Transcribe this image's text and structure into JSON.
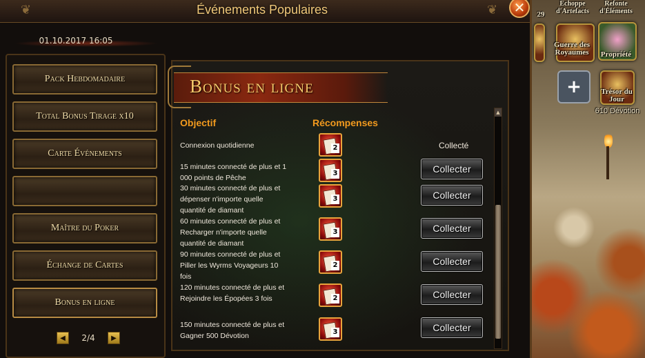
{
  "window": {
    "title": "Événements Populaires",
    "datetime": "01.10.2017 16:05",
    "close_icon": "close-icon"
  },
  "menu": {
    "items": [
      {
        "label": "Pack Hebdomadaire"
      },
      {
        "label": "Total Bonus Tirage x10"
      },
      {
        "label": "Carte Événements"
      },
      {
        "label": ""
      },
      {
        "label": "Maître du Poker"
      },
      {
        "label": "Échange de Cartes"
      },
      {
        "label": "Bonus en ligne"
      }
    ],
    "active_index": 6,
    "pager": {
      "text": "2/4"
    }
  },
  "content": {
    "banner": "Bonus en ligne",
    "headers": {
      "objective": "Objectif",
      "rewards": "Récompenses"
    },
    "rows": [
      {
        "objective": "Connexion quotidienne",
        "reward_qty": "2",
        "status": "Collecté"
      },
      {
        "objective": "15 minutes connecté de plus et 1 000 points de Pêche",
        "reward_qty": "3",
        "button": "Collecter"
      },
      {
        "objective": "30 minutes connecté de plus et dépenser n'importe quelle quantité de diamant",
        "reward_qty": "3",
        "button": "Collecter"
      },
      {
        "objective": "60 minutes connecté de plus et Recharger n'importe quelle quantité de diamant",
        "reward_qty": "3",
        "button": "Collecter"
      },
      {
        "objective": "90 minutes connecté de plus et Piller les Wyrms Voyageurs 10 fois",
        "reward_qty": "2",
        "button": "Collecter"
      },
      {
        "objective": "120 minutes connecté de plus et Rejoindre les Épopées 3 fois",
        "reward_qty": "2",
        "button": "Collecter"
      },
      {
        "objective": "150 minutes connecté de plus et Gagner 500 Dévotion",
        "reward_qty": "3",
        "button": "Collecter"
      }
    ]
  },
  "side": {
    "top_num": "29",
    "top_label_1": "Echoppe d'Artefacts",
    "top_label_2": "Refonte d'Éléments",
    "war": "Guerre des Royaumes",
    "property": "Propriété",
    "treasure": "Trésor du Jour",
    "devotion": "610 Dévotion"
  }
}
